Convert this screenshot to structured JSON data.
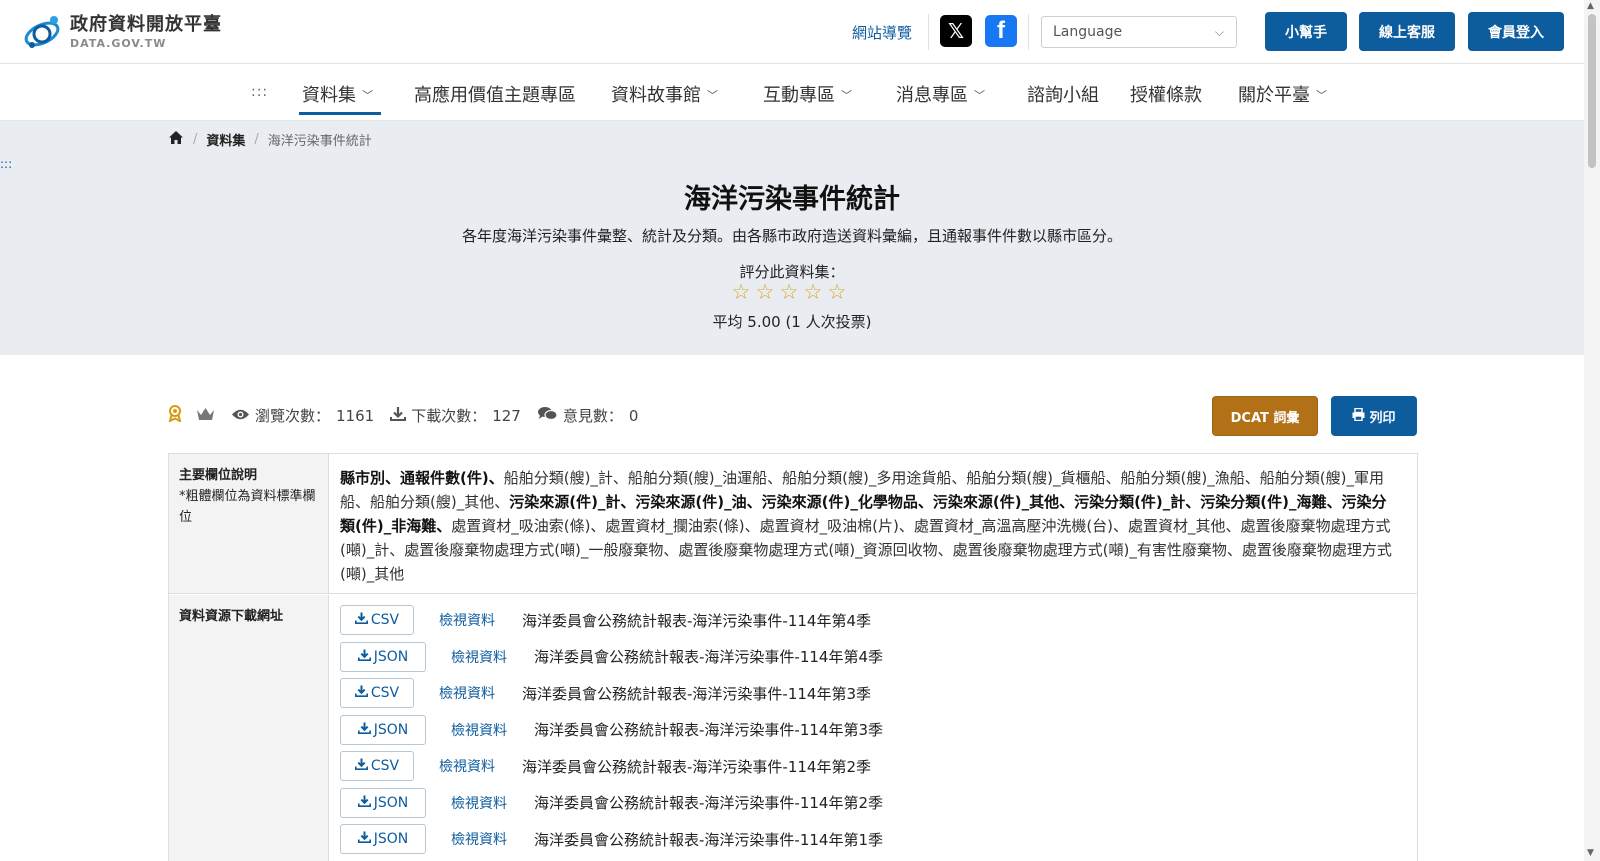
{
  "header": {
    "logo_title": "政府資料開放平臺",
    "logo_subtitle": "DATA.GOV.TW",
    "sitemap": "網站導覽",
    "language_placeholder": "Language",
    "buttons": {
      "helper": "小幫手",
      "support": "線上客服",
      "login": "會員登入"
    },
    "accent_color": "#0d5c9e"
  },
  "nav": {
    "dots": ":::",
    "items": [
      {
        "label": "資料集",
        "dropdown": true,
        "active": true
      },
      {
        "label": "高應用價值主題專區",
        "dropdown": false
      },
      {
        "label": "資料故事館",
        "dropdown": true
      },
      {
        "label": "互動專區",
        "dropdown": true
      },
      {
        "label": "消息專區",
        "dropdown": true
      },
      {
        "label": "諮詢小組",
        "dropdown": false
      },
      {
        "label": "授權條款",
        "dropdown": false
      },
      {
        "label": "關於平臺",
        "dropdown": true
      }
    ]
  },
  "breadcrumb": {
    "section": "資料集",
    "current": "海洋污染事件統計"
  },
  "side_dots": ":::",
  "dataset": {
    "title": "海洋污染事件統計",
    "description": "各年度海洋污染事件彙整、統計及分類。由各縣市政府造送資料彙編，且通報事件件數以縣市區分。",
    "rate_label": "評分此資料集：",
    "rating": 0,
    "average_text": "平均 5.00 (1 人次投票)"
  },
  "stats": {
    "views_label": "瀏覽次數：",
    "views": "1161",
    "downloads_label": "下載次數：",
    "downloads": "127",
    "comments_label": "意見數：",
    "comments": "0"
  },
  "actions": {
    "dcat": "DCAT 詞彙",
    "print": "列印"
  },
  "table": {
    "fields_label": "主要欄位說明",
    "fields_note": "*粗體欄位為資料標準欄位",
    "fields_part1_bold": "縣市別、通報件數(件)、",
    "fields_part2": "船舶分類(艘)_計、船舶分類(艘)_油運船、船舶分類(艘)_多用途貨船、船舶分類(艘)_貨櫃船、船舶分類(艘)_漁船、船舶分類(艘)_軍用船、船舶分類(艘)_其他、",
    "fields_part3_bold": "污染來源(件)_計、污染來源(件)_油、污染來源(件)_化學物品、污染來源(件)_其他、污染分類(件)_計、污染分類(件)_海難、污染分類(件)_非海難、",
    "fields_part4": "處置資材_吸油索(條)、處置資材_攔油索(條)、處置資材_吸油棉(片)、處置資材_高溫高壓沖洗機(台)、處置資材_其他、處置後廢棄物處理方式(噸)_計、處置後廢棄物處理方式(噸)_一般廢棄物、處置後廢棄物處理方式(噸)_資源回收物、處置後廢棄物處理方式(噸)_有害性廢棄物、處置後廢棄物處理方式(噸)_其他",
    "resources_label": "資料資源下載網址",
    "view_label": "檢視資料",
    "resources": [
      {
        "format": "CSV",
        "name": "海洋委員會公務統計報表-海洋污染事件-114年第4季"
      },
      {
        "format": "JSON",
        "name": "海洋委員會公務統計報表-海洋污染事件-114年第4季"
      },
      {
        "format": "CSV",
        "name": "海洋委員會公務統計報表-海洋污染事件-114年第3季"
      },
      {
        "format": "JSON",
        "name": "海洋委員會公務統計報表-海洋污染事件-114年第3季"
      },
      {
        "format": "CSV",
        "name": "海洋委員會公務統計報表-海洋污染事件-114年第2季"
      },
      {
        "format": "JSON",
        "name": "海洋委員會公務統計報表-海洋污染事件-114年第2季"
      },
      {
        "format": "JSON",
        "name": "海洋委員會公務統計報表-海洋污染事件-114年第1季"
      }
    ]
  }
}
